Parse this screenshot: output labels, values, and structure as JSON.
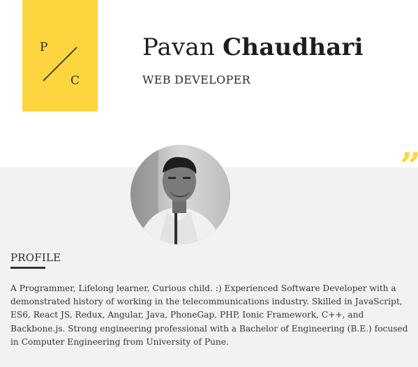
{
  "logo": {
    "letter_top": "P",
    "letter_bottom": "C"
  },
  "header": {
    "first_name": "Pavan",
    "last_name": "Chaudhari",
    "job_title": "WEB DEVELOPER"
  },
  "quote_mark": "”",
  "profile": {
    "heading": "PROFILE",
    "text": "A Programmer, Lifelong learner, Curious child. :) Experienced Software Developer with a demonstrated history of working in the telecommunications industry. Skilled in JavaScript, ES6, React JS, Redux, Angular, Java, PhoneGap, PHP, Ionic Framework, C++, and Backbone.js. Strong engineering professional with a Bachelor of Engineering (B.E.) focused in Computer Engineering from University of Pune."
  },
  "colors": {
    "accent": "#fdd63f",
    "band": "#f2f2f2",
    "text": "#2b2b2b"
  }
}
